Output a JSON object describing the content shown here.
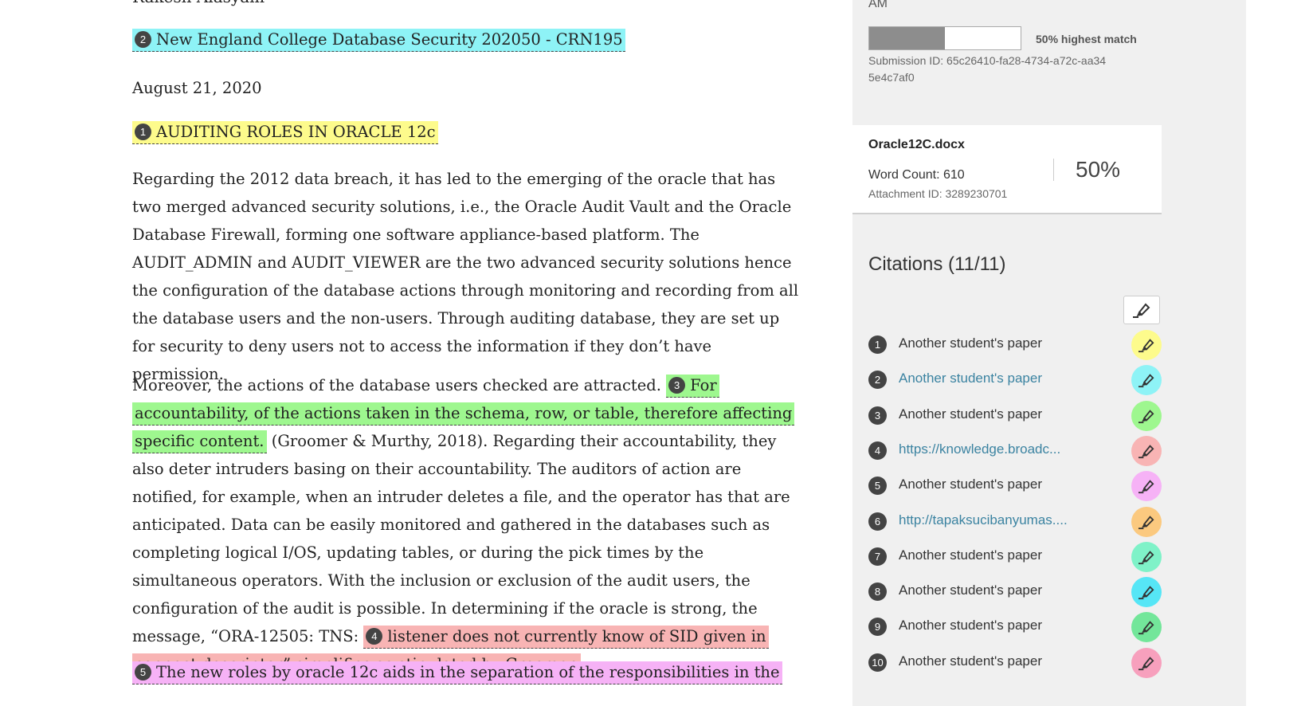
{
  "document": {
    "author": "Rakesh Alasyam",
    "course": {
      "badge": "2",
      "text": "New England College Database Security 202050 - CRN195"
    },
    "date": "August 21, 2020",
    "title": {
      "badge": "1",
      "text": "AUDITING ROLES IN ORACLE 12c"
    },
    "paragraph1": "Regarding the 2012 data breach, it has led to the emerging of the oracle that has two merged advanced security solutions, i.e., the Oracle Audit Vault and the Oracle Database Firewall, forming one software appliance-based platform. The AUDIT_ADMIN and AUDIT_VIEWER are the two advanced security solutions hence the configuration of the database actions through monitoring and recording from all the database users and the non-users. Through auditing database, they are set up for security to deny users not to access the information if they don’t have permission.",
    "paragraph2": {
      "lead": "Moreover, the actions of the database users checked are attracted.",
      "badge3": "3",
      "match3": "For accountability, of the actions taken in the schema, row, or table, therefore affecting specific content.",
      "middle": "(Groomer & Murthy, 2018). Regarding their accountability, they also deter intruders basing on their accountability. The auditors of action are notified, for example, when an intruder deletes a file, and the operator has that are anticipated. Data can be easily monitored and gathered in the databases such as completing logical I/OS, updating tables, or during the pick times by the simultaneous operators. With the inclusion or exclusion of the audit users, the configuration of the audit is possible. In determining if the oracle is strong, the message, “ORA-12505: TNS:",
      "badge4": "4",
      "match4": "listener does not currently know of SID given in connect descriptor” simplifies as stipulated by Groomer."
    },
    "paragraph3": {
      "badge": "5",
      "text": "The new roles by oracle 12c aids in the separation of the responsibilities in the"
    }
  },
  "panel": {
    "am_text": "AM",
    "match": {
      "percent": 50,
      "label": "50% highest match"
    },
    "submission_id": "Submission ID: 65c26410-fa28-4734-a72c-aa345e4c7af0",
    "file": {
      "name": "Oracle12C.docx",
      "word_count": "Word Count: 610",
      "attachment_id": "Attachment ID: 3289230701",
      "percent": "50%"
    },
    "citations_title": "Citations (11/11)",
    "filter_icon": "highlighter-icon",
    "citations": [
      {
        "num": "1",
        "source": "Another student's paper",
        "link": false,
        "color": "#fdfb8c"
      },
      {
        "num": "2",
        "source": "Another student's paper",
        "link": true,
        "color": "#8ef3f6"
      },
      {
        "num": "3",
        "source": "Another student's paper",
        "link": false,
        "color": "#9ef78f"
      },
      {
        "num": "4",
        "source": "https://knowledge.broadc...",
        "link": true,
        "color": "#f8b4b4"
      },
      {
        "num": "5",
        "source": "Another student's paper",
        "link": false,
        "color": "#f6b2f6"
      },
      {
        "num": "6",
        "source": "http://tapaksucibanyumas....",
        "link": true,
        "color": "#fbc97f"
      },
      {
        "num": "7",
        "source": "Another student's paper",
        "link": false,
        "color": "#7ff2c8"
      },
      {
        "num": "8",
        "source": "Another student's paper",
        "link": false,
        "color": "#56e6f6"
      },
      {
        "num": "9",
        "source": "Another student's paper",
        "link": false,
        "color": "#73e69a"
      },
      {
        "num": "10",
        "source": "Another student's paper",
        "link": false,
        "color": "#f7a0bd"
      }
    ]
  }
}
